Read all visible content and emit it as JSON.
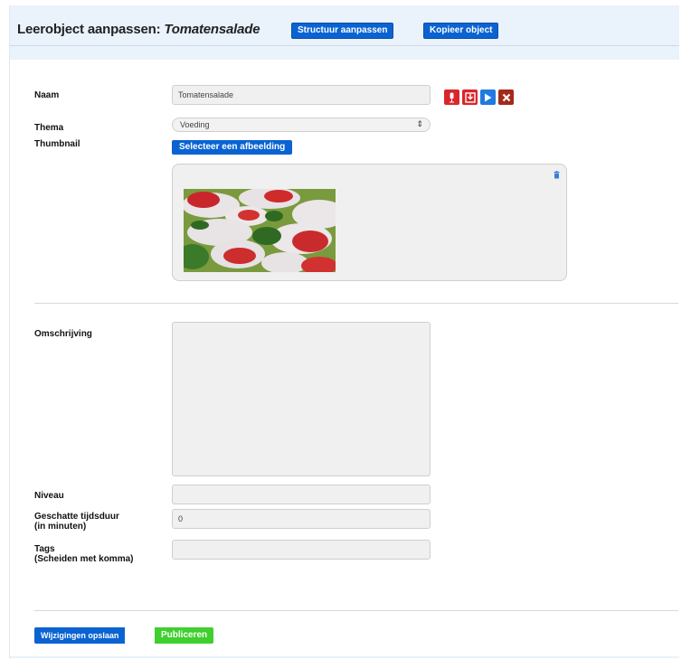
{
  "header": {
    "title_prefix": "Leerobject aanpassen: ",
    "title_object": "Tomatensalade",
    "btn_structuur": "Structuur aanpassen",
    "btn_kopieer": "Kopieer object"
  },
  "form": {
    "naam_label": "Naam",
    "naam_value": "Tomatensalade",
    "thema_label": "Thema",
    "thema_value": "Voeding",
    "thumbnail_label": "Thumbnail",
    "select_image_button": "Selecteer een afbeelding",
    "omschrijving_label": "Omschrijving",
    "niveau_label": "Niveau",
    "tijdsduur_label_line1": "Geschatte tijdsduur",
    "tijdsduur_label_line2": "(in minuten)",
    "tijdsduur_value": "0",
    "tags_label_line1": "Tags",
    "tags_label_line2": "(Scheiden met komma)"
  },
  "actions": {
    "save_button": "Wijzigingen opslaan",
    "publish_button": "Publiceren"
  },
  "icons": {
    "microphone": "microphone-icon",
    "save": "save-icon",
    "play": "play-icon",
    "delete": "delete-icon",
    "trash": "trash-icon"
  },
  "colors": {
    "primary_blue": "#0a63d1",
    "publish_green": "#3fcf2e",
    "icon_red": "#d9262b",
    "icon_darkred": "#a32a1b",
    "header_bg": "#eaf2fb"
  }
}
